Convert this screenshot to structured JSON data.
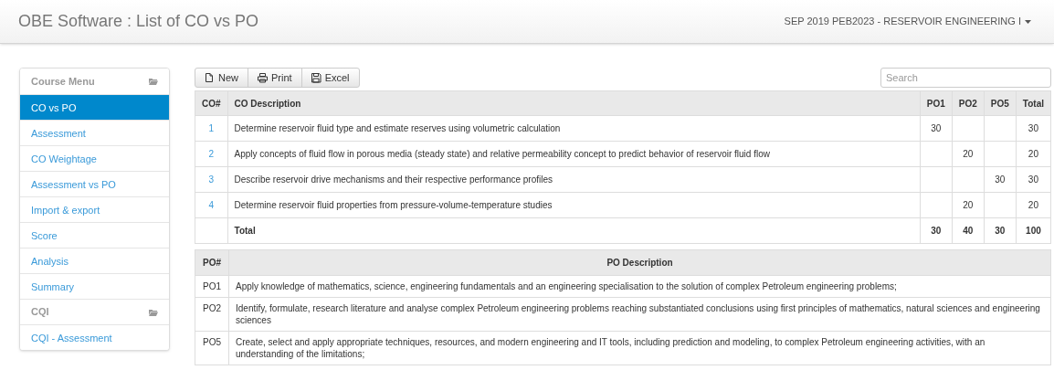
{
  "navbar": {
    "title": "OBE Software : List of CO vs PO",
    "course": "SEP 2019 PEB2023 - RESERVOIR ENGINEERING I"
  },
  "sidebar": {
    "items": [
      {
        "kind": "header",
        "label": "Course Menu"
      },
      {
        "kind": "link",
        "label": "CO vs PO",
        "selected": true
      },
      {
        "kind": "link",
        "label": "Assessment",
        "selected": false
      },
      {
        "kind": "link",
        "label": "CO Weightage",
        "selected": false
      },
      {
        "kind": "link",
        "label": "Assessment vs PO",
        "selected": false
      },
      {
        "kind": "link",
        "label": "Import & export",
        "selected": false
      },
      {
        "kind": "link",
        "label": "Score",
        "selected": false
      },
      {
        "kind": "link",
        "label": "Analysis",
        "selected": false
      },
      {
        "kind": "link",
        "label": "Summary",
        "selected": false
      },
      {
        "kind": "header",
        "label": "CQI"
      },
      {
        "kind": "link",
        "label": "CQI - Assessment",
        "selected": false
      }
    ]
  },
  "toolbar": {
    "buttons": [
      {
        "kind": "new",
        "label": "New"
      },
      {
        "kind": "print",
        "label": "Print"
      },
      {
        "kind": "excel",
        "label": "Excel"
      }
    ],
    "search": {
      "placeholder": "Search"
    }
  },
  "co_table": {
    "columns": [
      "CO#",
      "CO Description",
      "PO1",
      "PO2",
      "PO5",
      "Total"
    ],
    "rows": [
      [
        "1",
        "Determine reservoir fluid type and estimate reserves using volumetric calculation",
        "30",
        "",
        "",
        "30"
      ],
      [
        "2",
        "Apply concepts of fluid flow in porous media (steady state) and relative permeability concept to predict behavior of reservoir fluid flow",
        "",
        "20",
        "",
        "20"
      ],
      [
        "3",
        "Describe reservoir drive mechanisms and their respective performance profiles",
        "",
        "",
        "30",
        "30"
      ],
      [
        "4",
        "Determine reservoir fluid properties from pressure-volume-temperature studies",
        "",
        "20",
        "",
        "20"
      ]
    ],
    "total": {
      "label": "Total",
      "values": [
        "30",
        "40",
        "30",
        "100"
      ]
    }
  },
  "po_table": {
    "columns": [
      "PO#",
      "PO Description"
    ],
    "rows": [
      [
        "PO1",
        "Apply knowledge of mathematics, science, engineering fundamentals and an engineering specialisation to the solution of complex Petroleum engineering problems;"
      ],
      [
        "PO2",
        "Identify, formulate, research literature and analyse complex Petroleum engineering problems reaching substantiated conclusions using first principles of mathematics, natural sciences and engineering sciences"
      ],
      [
        "PO5",
        "Create, select and apply appropriate techniques, resources, and modern engineering and IT tools, including prediction and modeling, to complex Petroleum engineering activities, with an understanding of the limitations;"
      ]
    ]
  }
}
